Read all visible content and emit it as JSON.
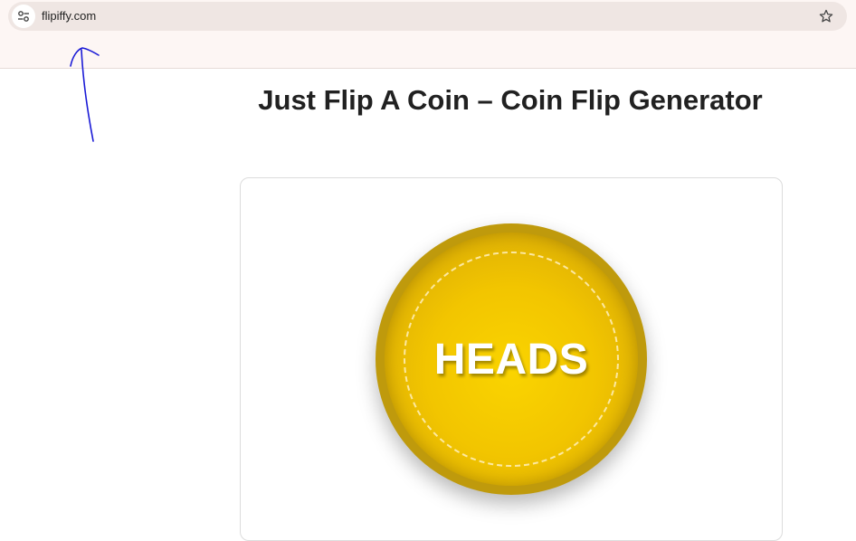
{
  "browser": {
    "url": "flipiffy.com",
    "site_info_icon": "tune-icon",
    "bookmark_icon": "star-icon"
  },
  "page": {
    "title": "Just Flip A Coin – Coin Flip Generator"
  },
  "coin": {
    "result": "HEADS",
    "colors": {
      "rim": "#bf9a0c",
      "face": "#f2c500",
      "text": "#ffffff"
    }
  },
  "annotation": {
    "type": "hand-drawn-arrow",
    "color": "#1a1ad6"
  }
}
